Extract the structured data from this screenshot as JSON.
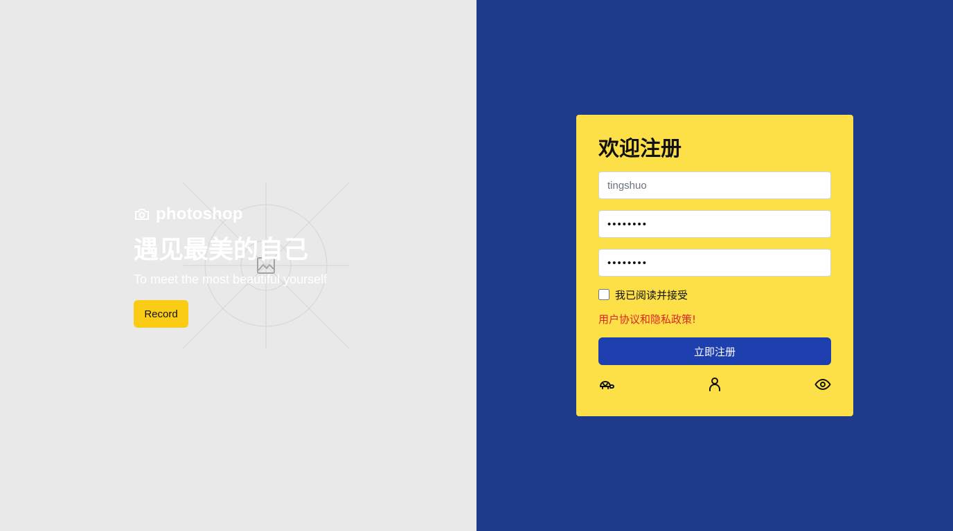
{
  "hero": {
    "brand_icon": "camera-icon",
    "brand_name": "photoshop",
    "title": "遇见最美的自己",
    "subtitle": "To meet the most beautiful yourself",
    "record_label": "Record",
    "image_placeholder_icon": "image-icon"
  },
  "register": {
    "title": "欢迎注册",
    "username_placeholder": "tingshuo",
    "password_value": "12345678",
    "confirm_password_value": "12345678",
    "agree_label": "我已阅读并接受",
    "agree_checked": false,
    "policy_link": "用户协议和隐私政策!",
    "submit_label": "立即注册",
    "footer_icons": [
      "turtle-icon",
      "user-icon",
      "eye-icon"
    ]
  },
  "colors": {
    "left_bg": "#e9e9e9",
    "right_bg": "#1e3a8a",
    "card_bg": "#fde047",
    "accent_button": "#1e40af",
    "record_button": "#facc15",
    "policy_link": "#dc2626"
  }
}
